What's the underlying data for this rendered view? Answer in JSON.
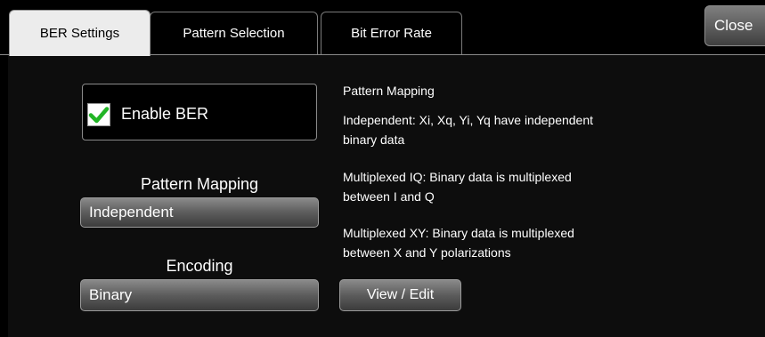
{
  "tabs": [
    {
      "label": "BER Settings",
      "active": true
    },
    {
      "label": "Pattern Selection",
      "active": false
    },
    {
      "label": "Bit Error Rate",
      "active": false
    }
  ],
  "close_label": "Close",
  "enable_ber": {
    "label": "Enable BER",
    "checked": true,
    "check_color": "#22b526"
  },
  "pattern_mapping": {
    "label": "Pattern Mapping",
    "value": "Independent"
  },
  "encoding": {
    "label": "Encoding",
    "value": "Binary"
  },
  "info": {
    "heading": "Pattern Mapping",
    "independent_line1": "Independent: Xi, Xq, Yi, Yq have independent",
    "independent_line2": "binary data",
    "mux_iq_line1": "Multiplexed IQ: Binary data is multiplexed",
    "mux_iq_line2": "between I and Q",
    "mux_xy_line1": "Multiplexed XY: Binary data is multiplexed",
    "mux_xy_line2": "between X and Y polarizations"
  },
  "view_edit_label": "View / Edit"
}
